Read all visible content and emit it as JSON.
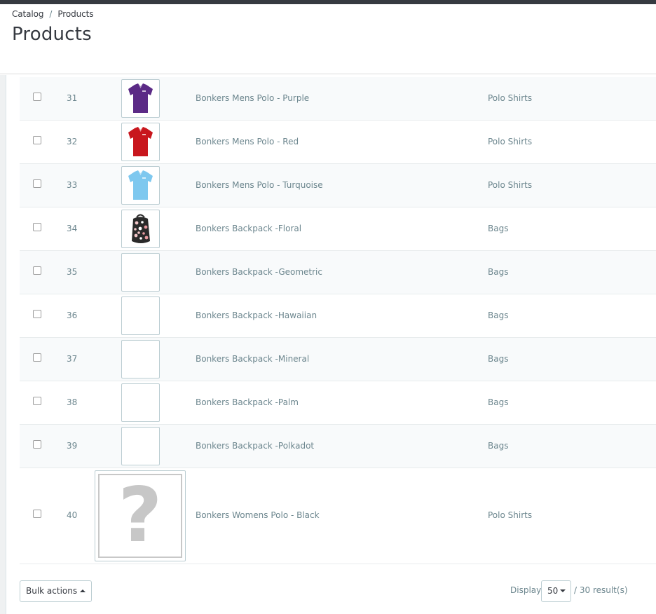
{
  "breadcrumb": {
    "parent": "Catalog",
    "separator": "/",
    "current": "Products"
  },
  "page_title": "Products",
  "products": [
    {
      "id": "31",
      "name": "Bonkers Mens Polo - Purple",
      "category": "Polo Shirts",
      "thumb": "polo",
      "color": "#5b2a86"
    },
    {
      "id": "32",
      "name": "Bonkers Mens Polo - Red",
      "category": "Polo Shirts",
      "thumb": "polo",
      "color": "#c8161d"
    },
    {
      "id": "33",
      "name": "Bonkers Mens Polo - Turquoise",
      "category": "Polo Shirts",
      "thumb": "polo",
      "color": "#7ec8ef"
    },
    {
      "id": "34",
      "name": "Bonkers Backpack -Floral",
      "category": "Bags",
      "thumb": "backpack",
      "color": "#2a2a2a"
    },
    {
      "id": "35",
      "name": "Bonkers Backpack -Geometric",
      "category": "Bags",
      "thumb": "blank",
      "color": "#ffffff"
    },
    {
      "id": "36",
      "name": "Bonkers Backpack -Hawaiian",
      "category": "Bags",
      "thumb": "blank",
      "color": "#ffffff"
    },
    {
      "id": "37",
      "name": "Bonkers Backpack -Mineral",
      "category": "Bags",
      "thumb": "blank",
      "color": "#ffffff"
    },
    {
      "id": "38",
      "name": "Bonkers Backpack -Palm",
      "category": "Bags",
      "thumb": "blank",
      "color": "#ffffff"
    },
    {
      "id": "39",
      "name": "Bonkers Backpack -Polkadot",
      "category": "Bags",
      "thumb": "blank",
      "color": "#ffffff"
    },
    {
      "id": "40",
      "name": "Bonkers Womens Polo - Black",
      "category": "Polo Shirts",
      "thumb": "placeholder",
      "color": "#c7c7c7"
    }
  ],
  "placeholder_glyph": "?",
  "footer": {
    "bulk_label": "Bulk actions",
    "display_label": "Display",
    "per_page": "50",
    "results": "/ 30 result(s)"
  }
}
